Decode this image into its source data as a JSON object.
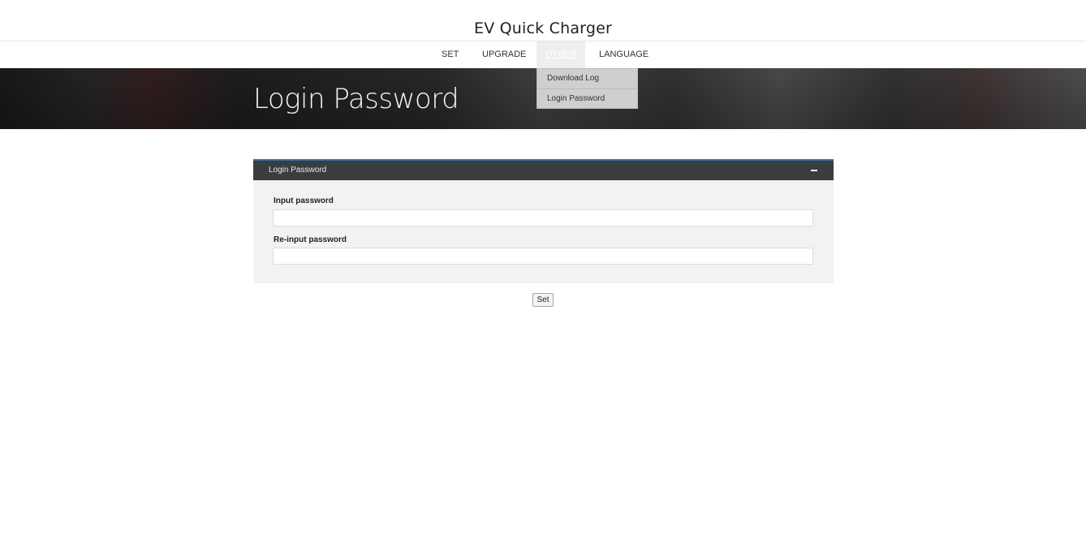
{
  "header": {
    "title": "EV Quick Charger"
  },
  "nav": {
    "items": [
      {
        "label": "SET"
      },
      {
        "label": "UPGRADE"
      },
      {
        "label": "OTHER",
        "active": true
      },
      {
        "label": "LANGUAGE"
      }
    ],
    "dropdown": [
      {
        "label": "Download Log"
      },
      {
        "label": "Login Password"
      }
    ]
  },
  "hero": {
    "title": "Login Password"
  },
  "panel": {
    "title": "Login Password",
    "collapse_icon": "minus-icon",
    "fields": [
      {
        "label": "Input password",
        "value": "",
        "placeholder": ""
      },
      {
        "label": "Re-input password",
        "value": "",
        "placeholder": ""
      }
    ]
  },
  "actions": {
    "set_label": "Set"
  },
  "colors": {
    "panel_header": "#3a3d40",
    "panel_accent": "#3d6f9a",
    "panel_body": "#f2f2f2",
    "dropdown_bg": "#cfcfcf"
  }
}
